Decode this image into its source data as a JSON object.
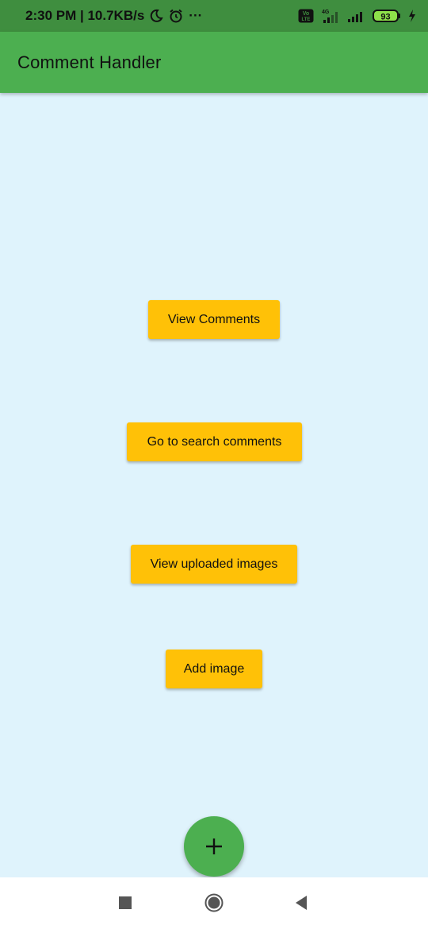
{
  "status_bar": {
    "time_speed": "2:30 PM | 10.7KB/s",
    "more": "···",
    "network_badge_top": "Vo",
    "network_badge_bottom": "LTE",
    "network_type": "4G",
    "battery": "93"
  },
  "app_bar": {
    "title": "Comment Handler"
  },
  "buttons": {
    "view_comments": "View Comments",
    "search_comments": "Go to search comments",
    "uploaded_images": "View uploaded images",
    "add_image": "Add image"
  },
  "fab": {
    "icon": "plus-icon"
  },
  "nav_bar": {
    "items": [
      "recents-square-icon",
      "home-circle-icon",
      "back-triangle-icon"
    ]
  },
  "colors": {
    "status_bar": "#3f8e3f",
    "app_bar": "#4caf50",
    "background": "#dff3fc",
    "button": "#ffc107",
    "fab": "#4caf50"
  }
}
